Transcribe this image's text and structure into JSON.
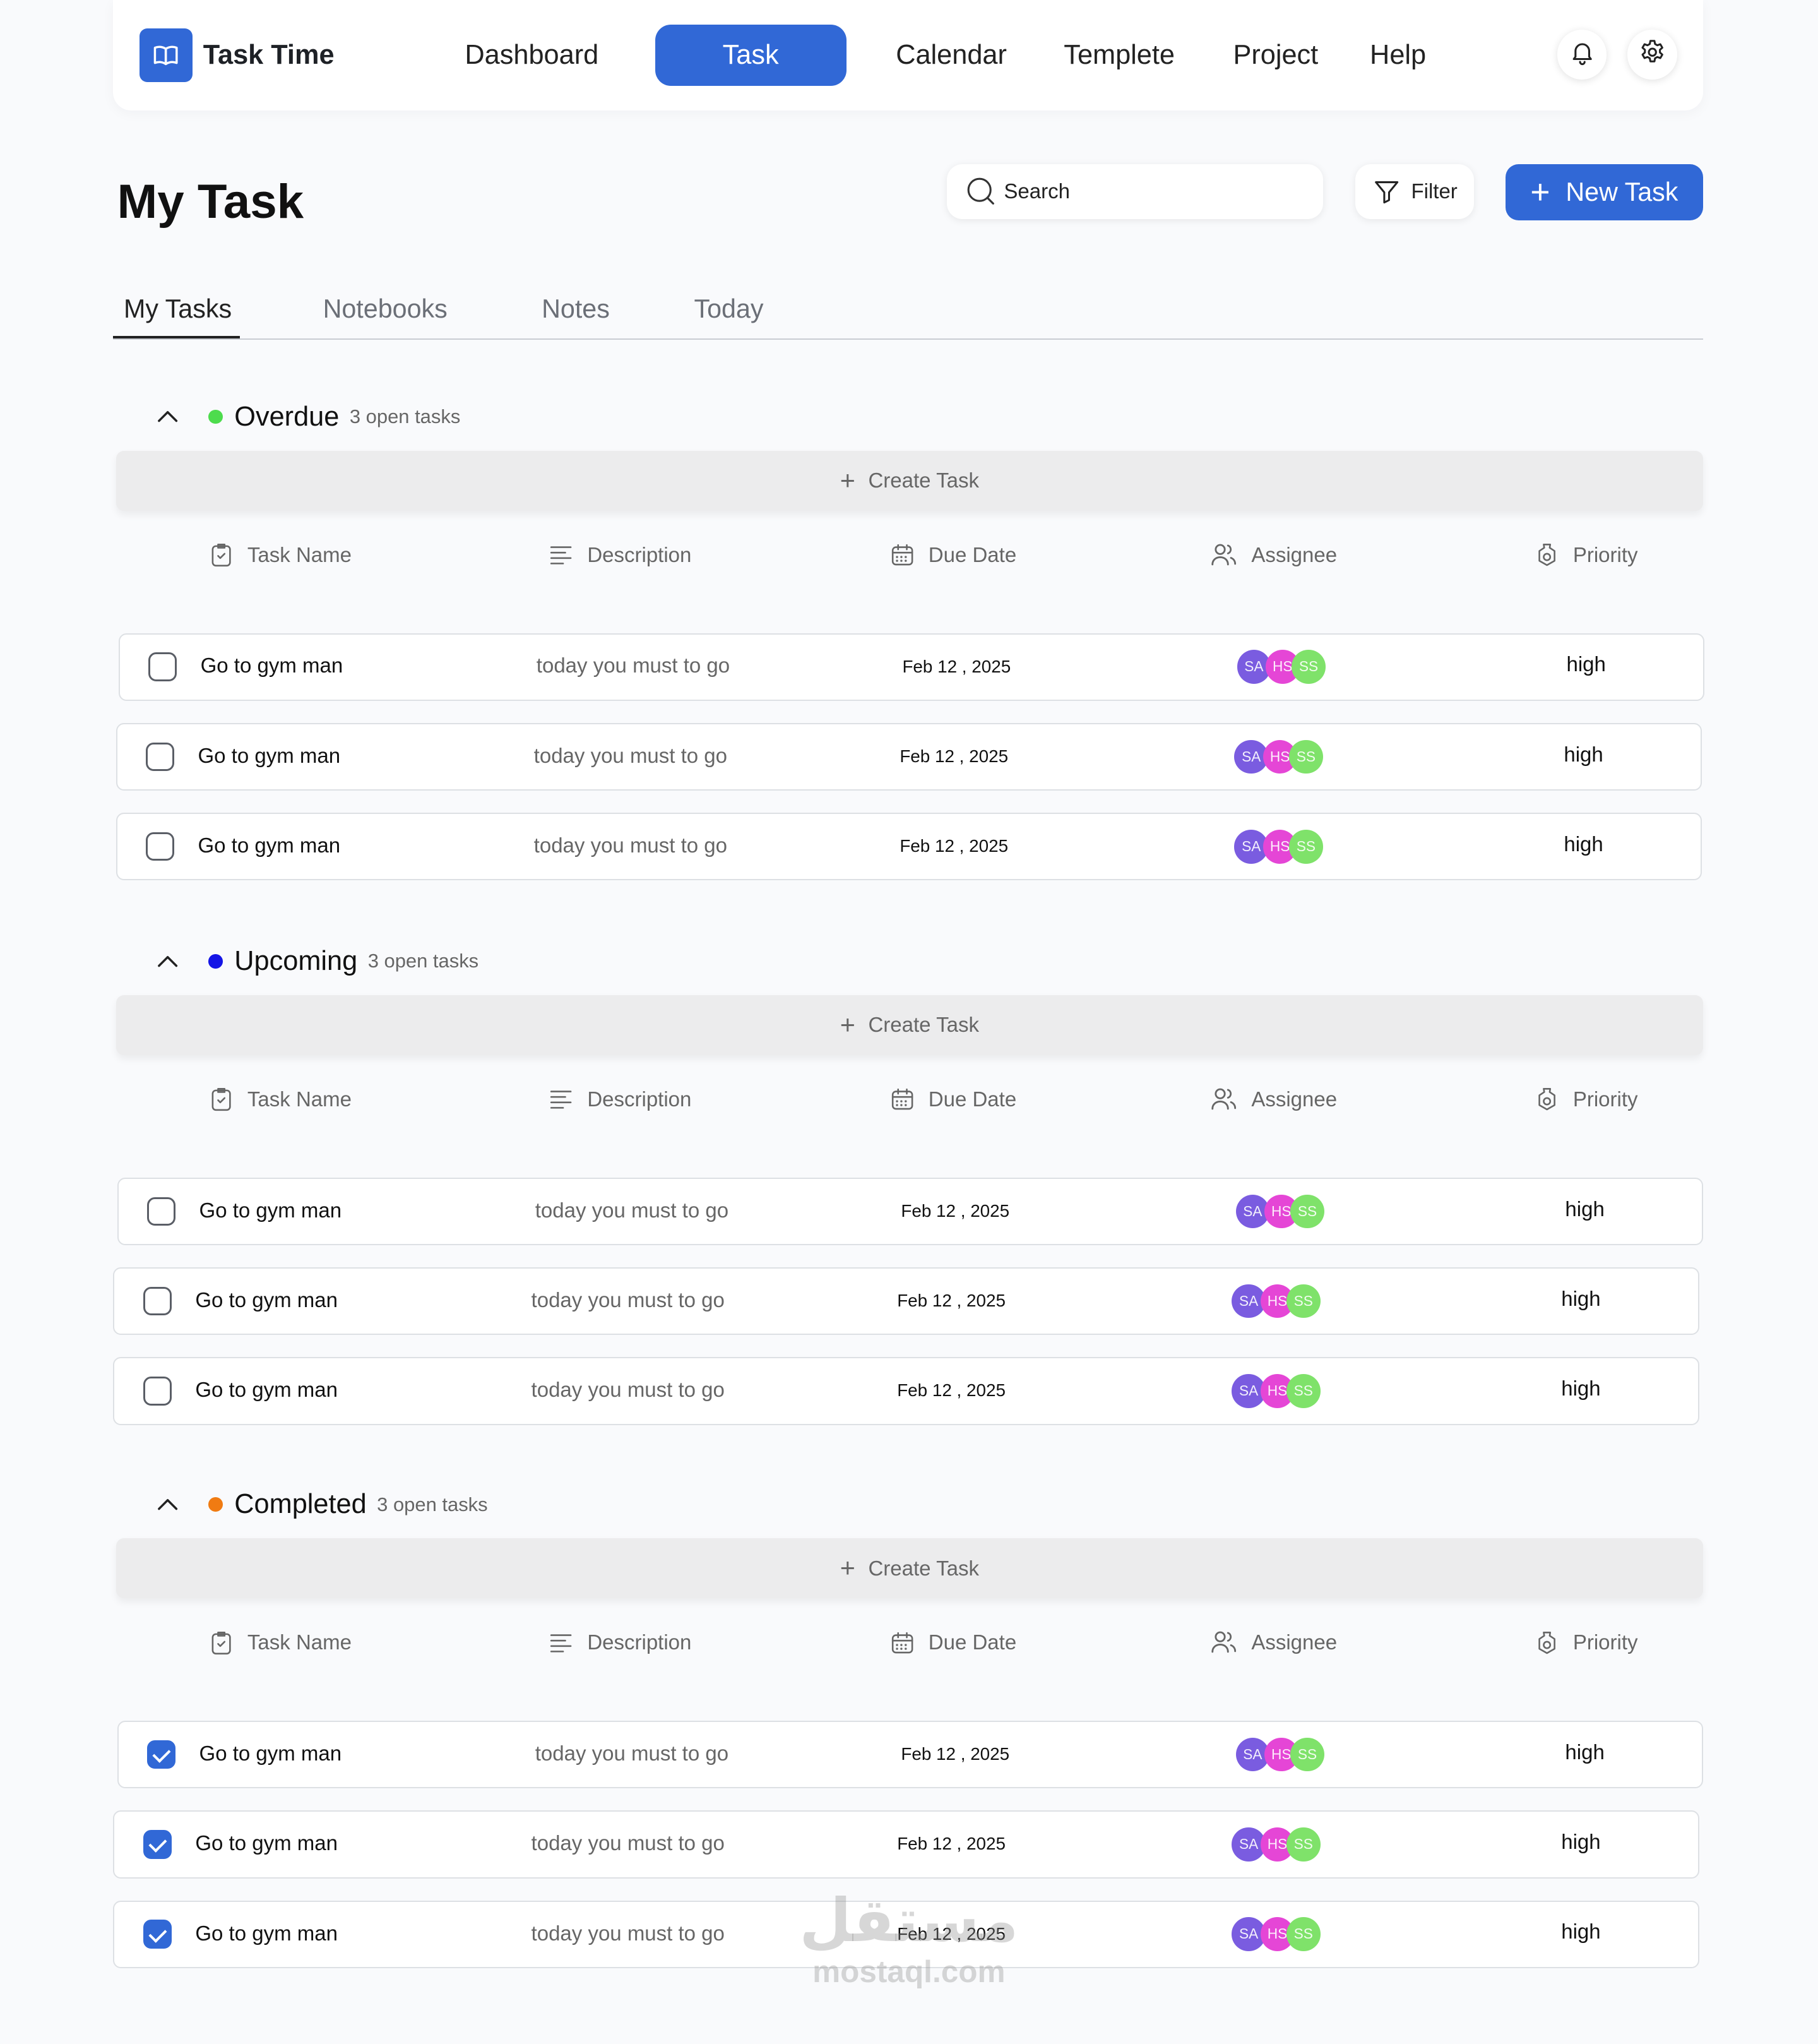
{
  "brand": {
    "name": "Task Time",
    "color": "#3168d6"
  },
  "nav": {
    "items": [
      {
        "label": "Dashboard",
        "active": false
      },
      {
        "label": "Task",
        "active": true
      },
      {
        "label": "Calendar",
        "active": false
      },
      {
        "label": "Templete",
        "active": false
      },
      {
        "label": "Project",
        "active": false
      },
      {
        "label": "Help",
        "active": false
      }
    ],
    "icons": [
      "bell-icon",
      "gear-icon"
    ]
  },
  "header": {
    "title": "My Task",
    "search_placeholder": "Search",
    "filter_label": "Filter",
    "new_task_label": "New Task"
  },
  "tabs": [
    {
      "label": "My Tasks",
      "active": true
    },
    {
      "label": "Notebooks",
      "active": false
    },
    {
      "label": "Notes",
      "active": false
    },
    {
      "label": "Today",
      "active": false
    }
  ],
  "columns": {
    "task_name": "Task Name",
    "description": "Description",
    "due_date": "Due Date",
    "assignee": "Assignee",
    "priority": "Priority"
  },
  "create_task_label": "Create Task",
  "avatar_colors": [
    "#7a5ce0",
    "#e546d6",
    "#7fe26a"
  ],
  "groups": [
    {
      "name": "Overdue",
      "count_text": "3 open tasks",
      "dot_color": "#4ddc4d",
      "rows": [
        {
          "name": "Go to gym man",
          "description": "today you must to go",
          "due": "Feb 12 , 2025",
          "assignees": [
            "SA",
            "HS",
            "SS"
          ],
          "priority": "high",
          "checked": false
        },
        {
          "name": "Go to gym man",
          "description": "today you must to go",
          "due": "Feb 12 , 2025",
          "assignees": [
            "SA",
            "HS",
            "SS"
          ],
          "priority": "high",
          "checked": false
        },
        {
          "name": "Go to gym man",
          "description": "today you must to go",
          "due": "Feb 12 , 2025",
          "assignees": [
            "SA",
            "HS",
            "SS"
          ],
          "priority": "high",
          "checked": false
        }
      ]
    },
    {
      "name": "Upcoming",
      "count_text": "3 open tasks",
      "dot_color": "#1515e6",
      "rows": [
        {
          "name": "Go to gym man",
          "description": "today you must to go",
          "due": "Feb 12 , 2025",
          "assignees": [
            "SA",
            "HS",
            "SS"
          ],
          "priority": "high",
          "checked": false
        },
        {
          "name": "Go to gym man",
          "description": "today you must to go",
          "due": "Feb 12 , 2025",
          "assignees": [
            "SA",
            "HS",
            "SS"
          ],
          "priority": "high",
          "checked": false
        },
        {
          "name": "Go to gym man",
          "description": "today you must to go",
          "due": "Feb 12 , 2025",
          "assignees": [
            "SA",
            "HS",
            "SS"
          ],
          "priority": "high",
          "checked": false
        }
      ]
    },
    {
      "name": "Completed",
      "count_text": "3 open tasks",
      "dot_color": "#f07b12",
      "rows": [
        {
          "name": "Go to gym man",
          "description": "today you must to go",
          "due": "Feb 12 , 2025",
          "assignees": [
            "SA",
            "HS",
            "SS"
          ],
          "priority": "high",
          "checked": true
        },
        {
          "name": "Go to gym man",
          "description": "today you must to go",
          "due": "Feb 12 , 2025",
          "assignees": [
            "SA",
            "HS",
            "SS"
          ],
          "priority": "high",
          "checked": true
        },
        {
          "name": "Go to gym man",
          "description": "today you must to go",
          "due": "Feb 12 , 2025",
          "assignees": [
            "SA",
            "HS",
            "SS"
          ],
          "priority": "high",
          "checked": true
        }
      ]
    }
  ],
  "watermark": {
    "arabic": "مستقل",
    "latin": "mostaql.com"
  }
}
